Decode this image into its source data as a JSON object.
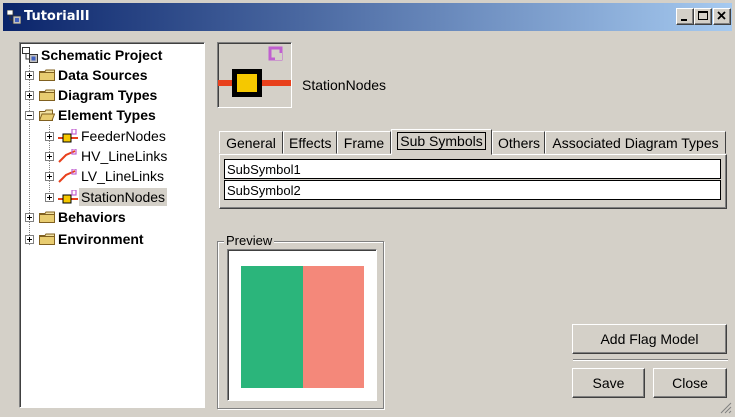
{
  "window": {
    "title": "TutorialII",
    "controls": [
      "minimize",
      "maximize",
      "close"
    ]
  },
  "tree": {
    "root": "Schematic Project",
    "items": [
      {
        "label": "Data Sources",
        "icon": "folder-icon",
        "bold": true
      },
      {
        "label": "Diagram Types",
        "icon": "folder-icon",
        "bold": true
      },
      {
        "label": "Element Types",
        "icon": "folder-open-icon",
        "bold": true
      },
      {
        "label": "FeederNodes",
        "icon": "node-symbol-icon",
        "bold": false
      },
      {
        "label": "HV_LineLinks",
        "icon": "link-symbol-icon",
        "bold": false
      },
      {
        "label": "LV_LineLinks",
        "icon": "link-symbol-icon",
        "bold": false
      },
      {
        "label": "StationNodes",
        "icon": "node-symbol-icon",
        "bold": false,
        "selected": true
      },
      {
        "label": "Behaviors",
        "icon": "folder-icon",
        "bold": true
      },
      {
        "label": "Environment",
        "icon": "folder-icon",
        "bold": true
      }
    ]
  },
  "element": {
    "name": "StationNodes",
    "icon": "station-node-symbol-icon",
    "colors": {
      "line": "#e8401c",
      "fill": "#f5c800",
      "flag": "#c060d0"
    }
  },
  "tabs": [
    {
      "label": "General"
    },
    {
      "label": "Effects"
    },
    {
      "label": "Frame"
    },
    {
      "label": "Sub Symbols",
      "active": true
    },
    {
      "label": "Others"
    },
    {
      "label": "Associated Diagram Types"
    }
  ],
  "sub_symbols": [
    "SubSymbol1",
    "SubSymbol2"
  ],
  "preview": {
    "label": "Preview",
    "colors": {
      "left": "#2bb57b",
      "right": "#f4887a"
    }
  },
  "buttons": {
    "add_flag_model": "Add Flag Model",
    "save": "Save",
    "close": "Close"
  }
}
